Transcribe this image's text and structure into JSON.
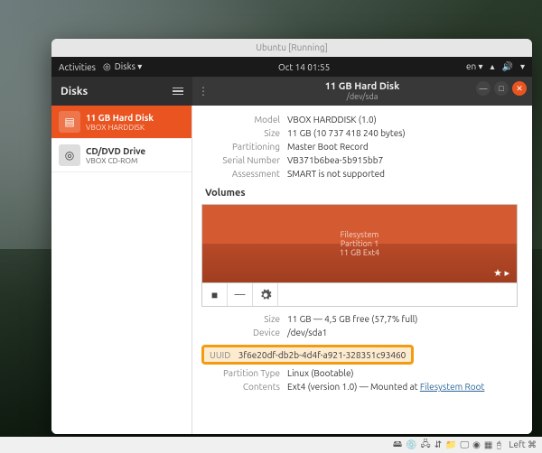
{
  "window_title": "Ubuntu [Running]",
  "topbar": {
    "activities": "Activities",
    "app_menu": "Disks ▾",
    "clock": "Oct 14  01:55",
    "lang": "en ▾"
  },
  "dock": {
    "items": [
      "firefox",
      "files",
      "software",
      "help",
      "terminal",
      "disks"
    ]
  },
  "app": {
    "sidebar_title": "Disks",
    "header_title": "11 GB Hard Disk",
    "header_sub": "/dev/sda"
  },
  "devices": [
    {
      "title": "11 GB Hard Disk",
      "sub": "VBOX HARDDISK",
      "icon": "hdd",
      "selected": true
    },
    {
      "title": "CD/DVD Drive",
      "sub": "VBOX CD-ROM",
      "icon": "cd",
      "selected": false
    }
  ],
  "info": {
    "model_label": "Model",
    "model": "VBOX HARDDISK (1.0)",
    "size_label": "Size",
    "size": "11 GB (10 737 418 240 bytes)",
    "partitioning_label": "Partitioning",
    "partitioning": "Master Boot Record",
    "serial_label": "Serial Number",
    "serial": "VB371b6bea-5b915bb7",
    "assessment_label": "Assessment",
    "assessment": "SMART is not supported"
  },
  "volumes": {
    "section_title": "Volumes",
    "label1": "Filesystem",
    "label2": "Partition 1",
    "label3": "11 GB Ext4",
    "star": "★ ▸"
  },
  "toolbar": {
    "stop": "■",
    "minus": "—",
    "gear": "⚙"
  },
  "partition": {
    "size_label": "Size",
    "size": "11 GB — 4,5 GB free (57,7% full)",
    "device_label": "Device",
    "device": "/dev/sda1",
    "uuid_label": "UUID",
    "uuid": "3f6e20df-db2b-4d4f-a921-328351c93460",
    "ptype_label": "Partition Type",
    "ptype": "Linux (Bootable)",
    "contents_label": "Contents",
    "contents_prefix": "Ext4 (version 1.0) — Mounted at ",
    "contents_link": "Filesystem Root"
  },
  "vm_status": {
    "text": "Left ⌘"
  }
}
